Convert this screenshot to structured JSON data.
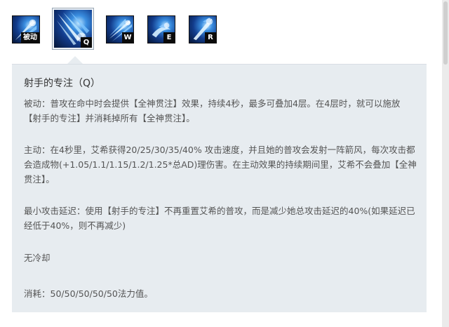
{
  "skills": [
    {
      "name": "passive",
      "key": "被动"
    },
    {
      "name": "q",
      "key": "Q"
    },
    {
      "name": "w",
      "key": "W"
    },
    {
      "name": "e",
      "key": "E"
    },
    {
      "name": "r",
      "key": "R"
    }
  ],
  "detail": {
    "title": "射手的专注（Q）",
    "passive_text": "被动：普攻在命中时会提供【全神贯注】效果，持续4秒，最多可叠加4层。在4层时，就可以施放【射手的专注】并消耗掉所有【全神贯注】。",
    "active_text": "主动：在4秒里，艾希获得20/25/30/35/40% 攻击速度，并且她的普攻会发射一阵箭风，每次攻击都会造成物(+1.05/1.1/1.15/1.2/1.25*总AD)理伤害。在主动效果的持续期间里，艾希不会叠加【全神贯注】。",
    "delay_text": "最小攻击延迟：使用【射手的专注】不再重置艾希的普攻，而是减少她总攻击延迟的40%(如果延迟已经低于40%，则不再减少)",
    "cooldown_text": "无冷却",
    "cost_text": "消耗：50/50/50/50/50法力值。"
  },
  "colors": {
    "panel_bg": "#e7ecf0",
    "icon_blue": "#3a8ee0"
  }
}
